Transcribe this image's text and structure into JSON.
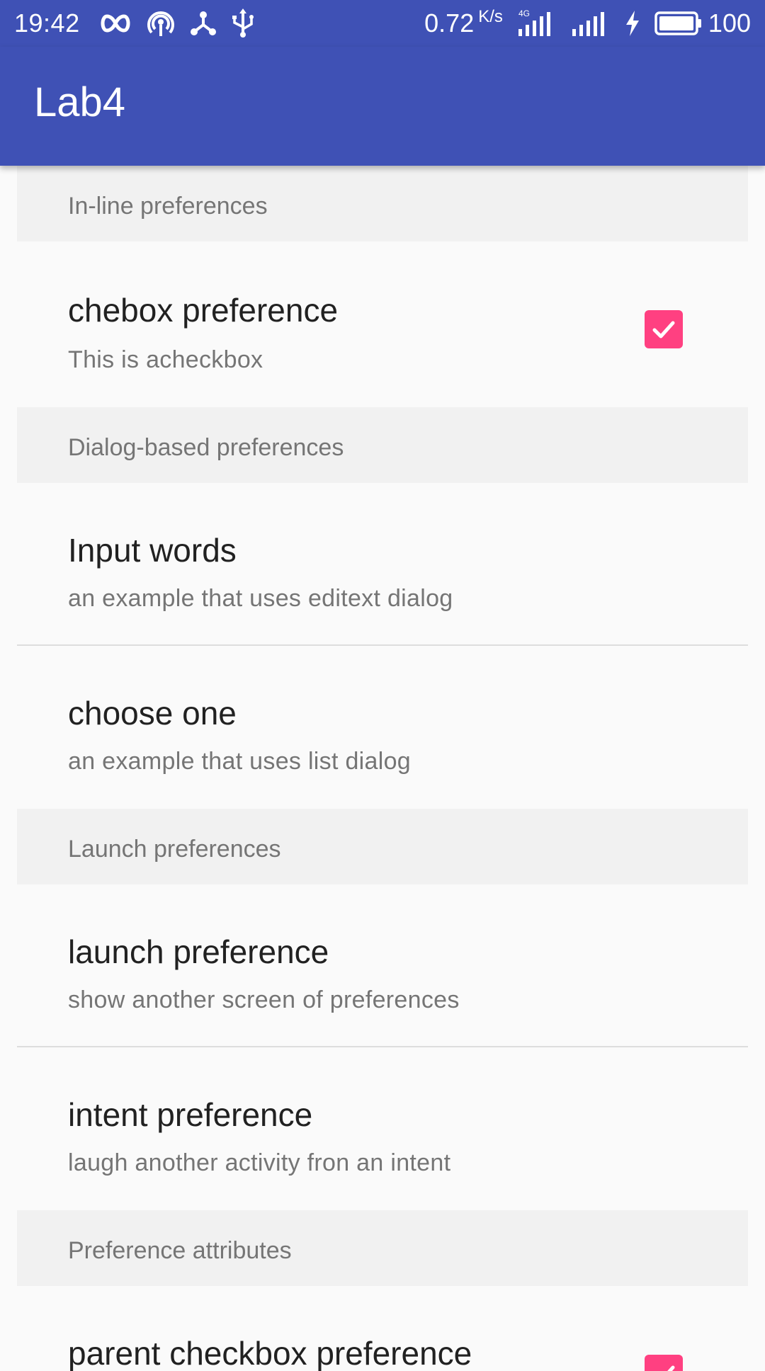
{
  "status_bar": {
    "time": "19:42",
    "network_speed": "0.72",
    "network_speed_unit": "K/s",
    "network_type": "4G",
    "battery_percent": "100",
    "icons": [
      "infinity-icon",
      "hotspot-icon",
      "share-icon",
      "usb-icon",
      "signal-4g-icon",
      "signal-icon",
      "charging-icon",
      "battery-icon"
    ]
  },
  "app_bar": {
    "title": "Lab4"
  },
  "colors": {
    "primary": "#3f51b5",
    "accent": "#ff4081",
    "background": "#fafafa",
    "category_background": "#f1f1f1"
  },
  "preferences": {
    "inline_category": {
      "title": "In-line preferences",
      "checkbox_pref": {
        "title": "chebox preference",
        "summary": "This is acheckbox",
        "checked": true
      }
    },
    "dialog_category": {
      "title": "Dialog-based preferences",
      "edit_text_pref": {
        "title": "Input words",
        "summary": "an example that uses editext dialog"
      },
      "list_pref": {
        "title": "choose one",
        "summary": "an example that uses list dialog"
      }
    },
    "launch_category": {
      "title": "Launch preferences",
      "launch_pref": {
        "title": "launch preference",
        "summary": "show another screen of preferences"
      },
      "intent_pref": {
        "title": "intent preference",
        "summary": "laugh another activity fron an intent"
      }
    },
    "attributes_category": {
      "title": "Preference attributes",
      "parent_checkbox_pref": {
        "title": "parent checkbox preference",
        "checked": true
      }
    }
  }
}
